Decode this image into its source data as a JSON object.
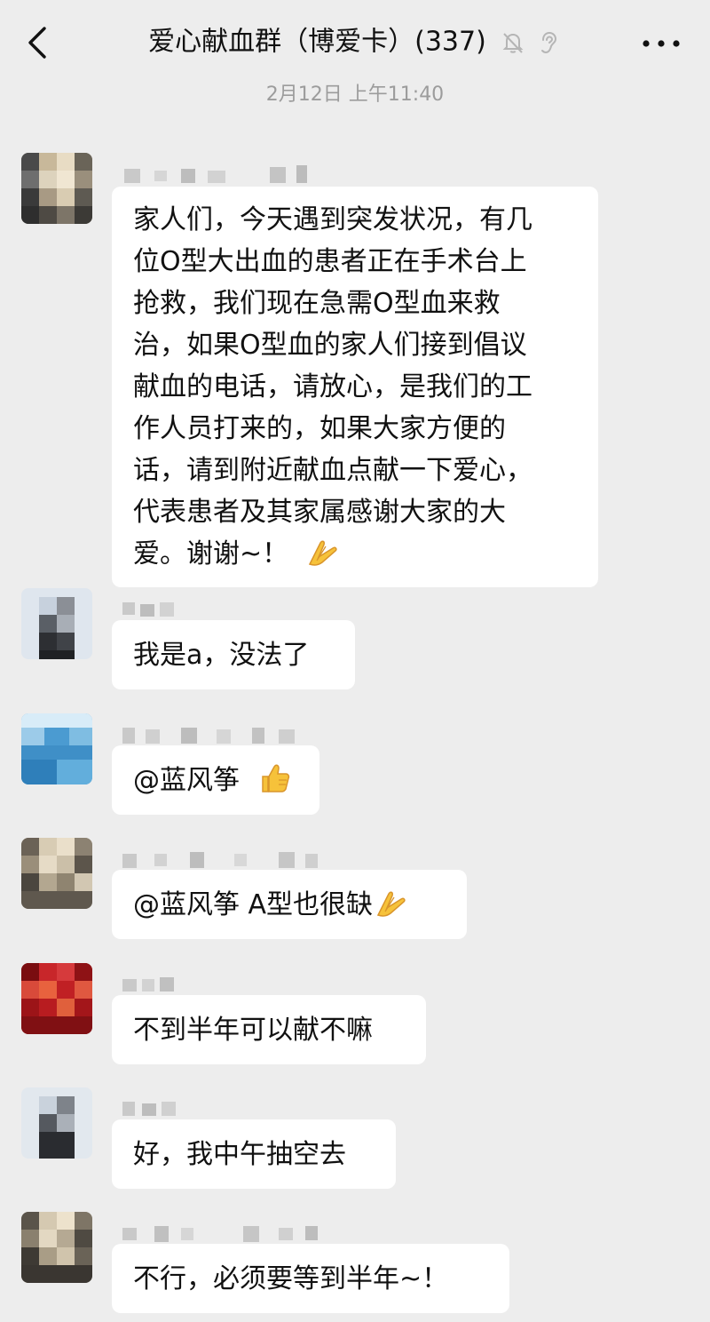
{
  "header": {
    "back_icon": "chevron-left-icon",
    "title": "爱心献血群（博爱卡）(337)",
    "mute_icon": "bell-muted-icon",
    "ear_icon": "ear-icon",
    "more_icon": "more-dots-icon"
  },
  "timestamp": "2月12日 上午11:40",
  "messages": [
    {
      "lines": [
        "家人们，今天遇到突发状况，有几",
        "位O型大出血的患者正在手术台上",
        "抢救，我们现在急需O型血来救",
        "治，如果O型血的家人们接到倡议",
        "献血的电话，请放心，是我们的工",
        "作人员打来的，如果大家方便的",
        "话，请到附近献血点献一下爱心，",
        "代表患者及其家属感谢大家的大",
        "爱。谢谢~！"
      ],
      "emoji": "folded-hands-emoji"
    },
    {
      "text": "我是a，没法了"
    },
    {
      "text": "@蓝风筝",
      "emoji": "thumbs-up-emoji"
    },
    {
      "text": "@蓝风筝 A型也很缺",
      "emoji": "folded-hands-emoji"
    },
    {
      "text": "不到半年可以献不嘛"
    },
    {
      "text": "好，我中午抽空去"
    },
    {
      "text": "不行，必须要等到半年~！"
    }
  ]
}
